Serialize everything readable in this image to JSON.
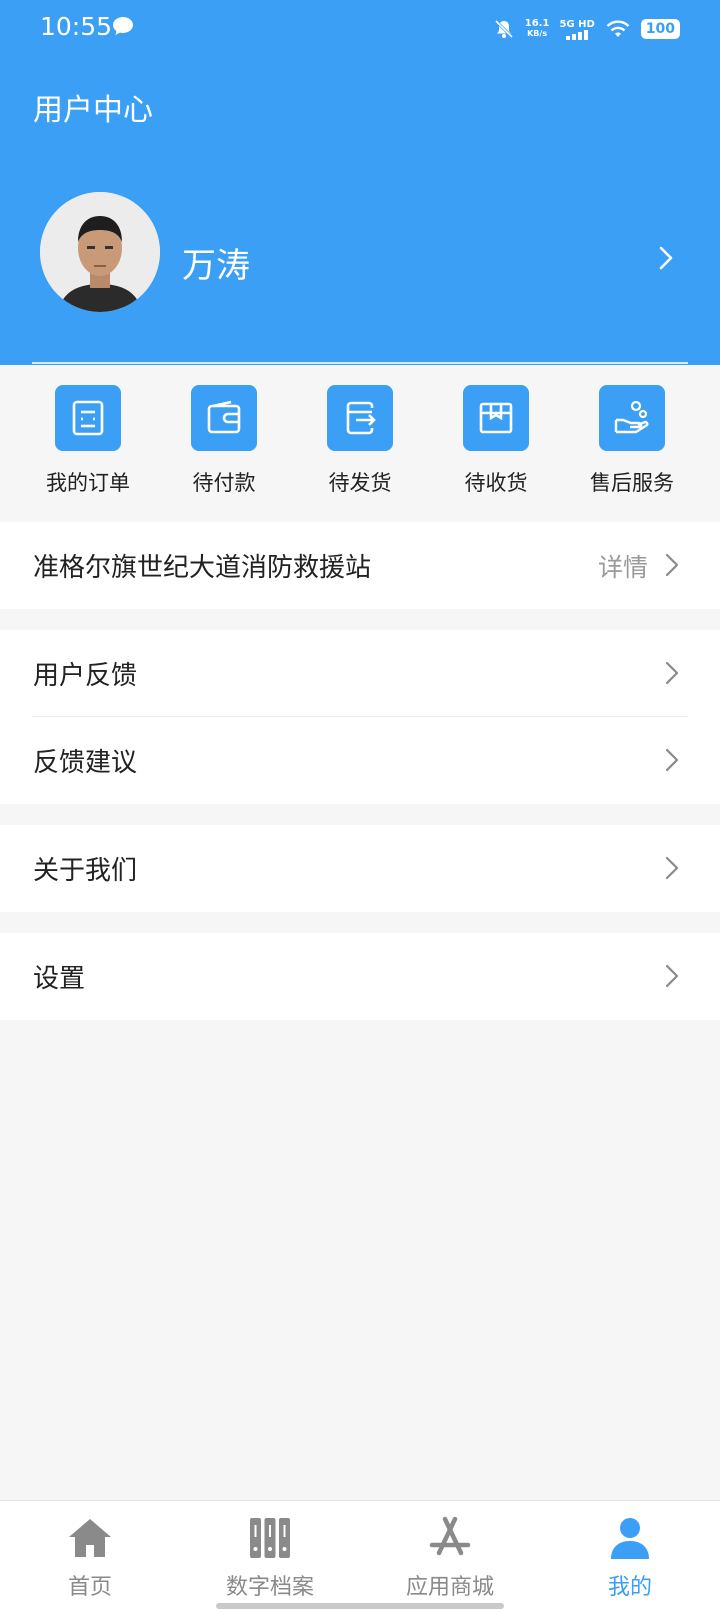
{
  "status_bar": {
    "time": "10:55",
    "net_speed_value": "16.1",
    "net_speed_unit": "KB/s",
    "network_type": "5G HD",
    "battery": "100"
  },
  "header": {
    "title": "用户中心",
    "user_name": "万涛"
  },
  "orders": [
    {
      "label": "我的订单",
      "icon": "order-list-icon"
    },
    {
      "label": "待付款",
      "icon": "wallet-icon"
    },
    {
      "label": "待发货",
      "icon": "ship-out-icon"
    },
    {
      "label": "待收货",
      "icon": "package-icon"
    },
    {
      "label": "售后服务",
      "icon": "hand-service-icon"
    }
  ],
  "organization": {
    "name": "准格尔旗世纪大道消防救援站",
    "detail_label": "详情"
  },
  "menu_group_1": [
    {
      "label": "用户反馈"
    },
    {
      "label": "反馈建议"
    }
  ],
  "menu_group_2": [
    {
      "label": "关于我们"
    }
  ],
  "menu_group_3": [
    {
      "label": "设置"
    }
  ],
  "tabbar": {
    "items": [
      {
        "label": "首页",
        "icon": "home-icon"
      },
      {
        "label": "数字档案",
        "icon": "archive-icon"
      },
      {
        "label": "应用商城",
        "icon": "app-store-icon"
      },
      {
        "label": "我的",
        "icon": "user-icon",
        "active": true
      }
    ]
  },
  "colors": {
    "accent": "#3a9ff5",
    "background": "#f6f6f6",
    "tab_inactive": "#8a8a8a"
  }
}
